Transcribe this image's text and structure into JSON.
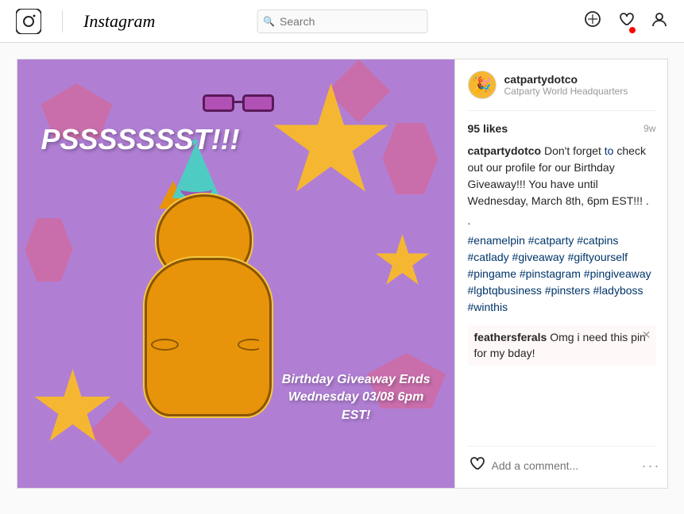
{
  "header": {
    "logo_text": "Instagram",
    "search_placeholder": "Search",
    "nav_icons": {
      "compass": "⊘",
      "heart": "♡",
      "profile": "👤"
    }
  },
  "post": {
    "username": "catpartydotco",
    "tagline": "Catparty World Headquarters",
    "avatar_emoji": "🎉",
    "likes": "95 likes",
    "time_ago": "9w",
    "caption_username": "catpartydotco",
    "caption_text": " Don't forget ",
    "caption_link": "to",
    "caption_text2": " check out our profile for our Birthday Giveaway!!! You have until Wednesday, March 8th, 6pm EST!!! .",
    "hashtags": "#enamelpin #catparty #catpins #catlady #giveaway #giftyourself #pingame #pinstagram #pingiveaway #lgbtqbusiness #pinsters #ladyboss #winthis",
    "comment_username": "feathersferals",
    "comment_text": " Omg i need this pin for my bday!",
    "comment_input_placeholder": "Add a comment...",
    "image_text_top": "PSSSSSSST!!!",
    "image_text_bottom": "Birthday Giveaway Ends\nWednesday 03/08 6pm\nEST!"
  }
}
